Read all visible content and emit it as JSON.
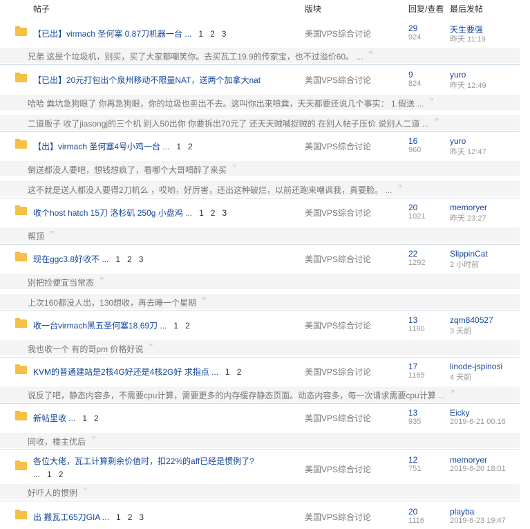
{
  "header": {
    "col_thread": "帖子",
    "col_forum": "版块",
    "col_replies": "回复/查看",
    "col_last": "最后发帖"
  },
  "threads": [
    {
      "title": "【已出】virmach 圣何塞 0.87刀机器一台 ...",
      "pages": [
        "1",
        "2",
        "3"
      ],
      "forum": "美国VPS综合讨论",
      "replies": "29",
      "views": "924",
      "last_user": "天生要强",
      "last_time": "昨天 11:19",
      "quotes": [
        "兄弟 这是个垃圾机，别买，买了大家都嘲笑你。去买瓦工19.9的传家宝，也不过溢价60。 ..."
      ]
    },
    {
      "title": "【已出】20元打包出个泉州移动不限量NAT，送两个加拿大nat",
      "pages": [],
      "forum": "美国VPS综合讨论",
      "replies": "9",
      "views": "824",
      "last_user": "yuro",
      "last_time": "昨天 12:49",
      "quotes": [
        "哈哈 粪坑急狗眼了 你再急狗眼，你的垃圾也卖出不去。这叫你出来喷粪，天天都要还说几个事实： 1.假送 ...",
        "二道贩子 收了jiasongj的三个机 别人50出你 你要拆出70元了 还天天贼喊捉贼的 在别人帖子压价 说别人二道 ..."
      ]
    },
    {
      "title": "【出】virmach 圣何塞4号小鸡一台 ...",
      "pages": [
        "1",
        "2"
      ],
      "forum": "美国VPS综合讨论",
      "replies": "16",
      "views": "960",
      "last_user": "yuro",
      "last_time": "昨天 12:47",
      "quotes": [
        "倒送都没人要吧，想钱想疯了，看哪个大哥喝醉了来买",
        "这不就是送人都没人要得2刀机么 ，哎哟，好厉害，还出这种破烂，以前还跑来嘲讽我，真要脸。 ..."
      ]
    },
    {
      "title": "收个host hatch 15刀 洛杉矶 250g 小盘鸡 ...",
      "pages": [
        "1",
        "2",
        "3"
      ],
      "forum": "美国VPS综合讨论",
      "replies": "20",
      "views": "1021",
      "last_user": "memoryer",
      "last_time": "昨天 23:27",
      "quotes": [
        "帮顶"
      ]
    },
    {
      "title": "现在ggc3.8好收不 ...",
      "pages": [
        "1",
        "2",
        "3"
      ],
      "forum": "美国VPS综合讨论",
      "replies": "22",
      "views": "1292",
      "last_user": "SlippinCat",
      "last_time": "2 小时前",
      "quotes": [
        "别把捡便宜当常态",
        "上次160都没人出，130想收，再去睡一个星期"
      ]
    },
    {
      "title": "收一台virmach黑五圣何塞18.69刀 ...",
      "pages": [
        "1",
        "2"
      ],
      "forum": "美国VPS综合讨论",
      "replies": "13",
      "views": "1180",
      "last_user": "zqm840527",
      "last_time": "3 天前",
      "quotes": [
        "我也收一个 有的哥pm 价格好说"
      ]
    },
    {
      "title": "KVM的普通建站是2核4G好还是4核2G好 求指点 ...",
      "pages": [
        "1",
        "2"
      ],
      "forum": "美国VPS综合讨论",
      "replies": "17",
      "views": "1165",
      "last_user": "linode-jspinosi",
      "last_time": "4 天前",
      "quotes": [
        "说反了吧，静态内容多，不需要cpu计算，需要更多的内存缓存静态页面。动态内容多，每一次请求需要cpu计算 ..."
      ]
    },
    {
      "title": "新帖里收 ...",
      "pages": [
        "1",
        "2"
      ],
      "forum": "美国VPS综合讨论",
      "replies": "13",
      "views": "935",
      "last_user": "Eicky",
      "last_time": "2019-6-21 00:16",
      "quotes": [
        "同收，楼主优后"
      ]
    },
    {
      "title": "各位大佬，瓦工计算剩余价值时，扣22%的aff已经是惯例了?",
      "title2": "...",
      "pages": [
        "1",
        "2"
      ],
      "forum": "美国VPS综合讨论",
      "replies": "12",
      "views": "751",
      "last_user": "memoryer",
      "last_time": "2019-6-20 18:01",
      "quotes": [
        "好吓人的惯例"
      ]
    },
    {
      "title": "出 搬瓦工65刀GIA ...",
      "pages": [
        "1",
        "2",
        "3"
      ],
      "forum": "美国VPS综合讨论",
      "replies": "20",
      "views": "1116",
      "last_user": "playba",
      "last_time": "2019-6-23 19:47",
      "quotes": []
    }
  ]
}
